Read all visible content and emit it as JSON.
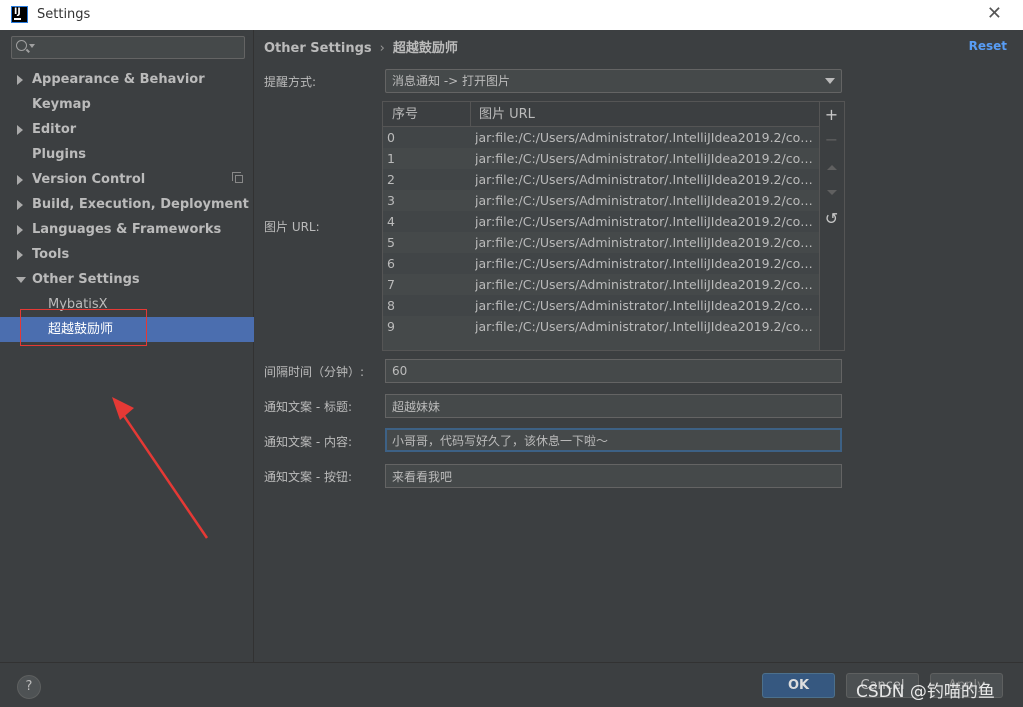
{
  "window": {
    "title": "Settings",
    "close_glyph": "✕"
  },
  "sidebar": {
    "search": {
      "value": "",
      "placeholder": ""
    },
    "items": [
      {
        "label": "Appearance & Behavior",
        "expandable": true,
        "expanded": false
      },
      {
        "label": "Keymap",
        "expandable": false
      },
      {
        "label": "Editor",
        "expandable": true,
        "expanded": false
      },
      {
        "label": "Plugins",
        "expandable": false
      },
      {
        "label": "Version Control",
        "expandable": true,
        "expanded": false,
        "badge_icon": "copy-icon"
      },
      {
        "label": "Build, Execution, Deployment",
        "expandable": true,
        "expanded": false
      },
      {
        "label": "Languages & Frameworks",
        "expandable": true,
        "expanded": false
      },
      {
        "label": "Tools",
        "expandable": true,
        "expanded": false
      },
      {
        "label": "Other Settings",
        "expandable": true,
        "expanded": true
      }
    ],
    "sub_items": [
      {
        "label": "MybatisX",
        "selected": false
      },
      {
        "label": "超越鼓励师",
        "selected": true
      }
    ]
  },
  "main": {
    "breadcrumb": {
      "parent": "Other Settings",
      "separator": "›",
      "current": "超越鼓励师"
    },
    "reset_label": "Reset",
    "reminder": {
      "label": "提醒方式:",
      "value": "消息通知 -> 打开图片"
    },
    "image_url": {
      "label": "图片 URL:",
      "columns": [
        "序号",
        "图片 URL"
      ],
      "rows": [
        {
          "index": "0",
          "url": "jar:file:/C:/Users/Administrator/.IntelliJIdea2019.2/config/..."
        },
        {
          "index": "1",
          "url": "jar:file:/C:/Users/Administrator/.IntelliJIdea2019.2/config/..."
        },
        {
          "index": "2",
          "url": "jar:file:/C:/Users/Administrator/.IntelliJIdea2019.2/config/..."
        },
        {
          "index": "3",
          "url": "jar:file:/C:/Users/Administrator/.IntelliJIdea2019.2/config/..."
        },
        {
          "index": "4",
          "url": "jar:file:/C:/Users/Administrator/.IntelliJIdea2019.2/config/..."
        },
        {
          "index": "5",
          "url": "jar:file:/C:/Users/Administrator/.IntelliJIdea2019.2/config/..."
        },
        {
          "index": "6",
          "url": "jar:file:/C:/Users/Administrator/.IntelliJIdea2019.2/config/..."
        },
        {
          "index": "7",
          "url": "jar:file:/C:/Users/Administrator/.IntelliJIdea2019.2/config/..."
        },
        {
          "index": "8",
          "url": "jar:file:/C:/Users/Administrator/.IntelliJIdea2019.2/config/..."
        },
        {
          "index": "9",
          "url": "jar:file:/C:/Users/Administrator/.IntelliJIdea2019.2/config/..."
        }
      ],
      "toolbar": {
        "add": "+",
        "remove": "−",
        "restore": "↺"
      }
    },
    "interval": {
      "label": "间隔时间（分钟）:",
      "value": "60"
    },
    "notify_title": {
      "label": "通知文案 - 标题:",
      "value": "超越妹妹"
    },
    "notify_content": {
      "label": "通知文案 - 内容:",
      "value": "小哥哥，代码写好久了，该休息一下啦～"
    },
    "notify_button": {
      "label": "通知文案 - 按钮:",
      "value": "来看看我吧"
    }
  },
  "footer": {
    "help_label": "?",
    "ok_label": "OK",
    "cancel_label": "Cancel",
    "apply_label": "Apply"
  },
  "watermark": "CSDN @钓喵的鱼",
  "colors": {
    "background": "#3c3f41",
    "selection": "#4b6eaf",
    "link": "#589df6",
    "primary_button": "#365880",
    "annotation": "#e53935"
  }
}
